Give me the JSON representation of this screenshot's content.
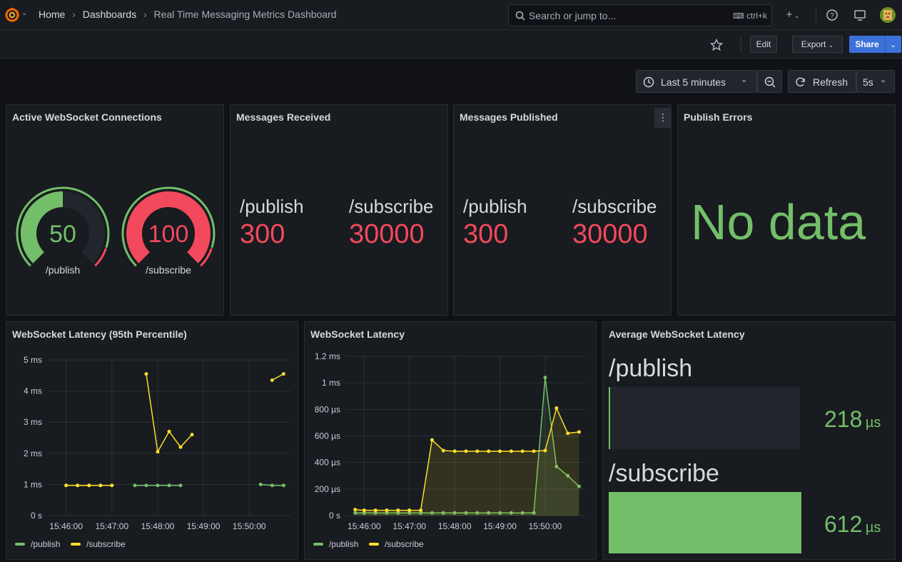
{
  "breadcrumb": {
    "home": "Home",
    "dashboards": "Dashboards",
    "current": "Real Time Messaging Metrics Dashboard"
  },
  "search": {
    "placeholder": "Search or jump to...",
    "shortcut": "ctrl+k"
  },
  "toolbar": {
    "edit": "Edit",
    "export": "Export",
    "share": "Share"
  },
  "time": {
    "range": "Last 5 minutes",
    "refresh": "Refresh",
    "interval": "5s"
  },
  "panels": {
    "connections": {
      "title": "Active WebSocket Connections",
      "gauges": [
        {
          "label": "/publish",
          "value": "50",
          "fraction": 0.5,
          "color": "#73bf69"
        },
        {
          "label": "/subscribe",
          "value": "100",
          "fraction": 1.0,
          "color": "#f2495c"
        }
      ]
    },
    "received": {
      "title": "Messages Received",
      "items": [
        {
          "label": "/publish",
          "value": "300"
        },
        {
          "label": "/subscribe",
          "value": "30000"
        }
      ]
    },
    "published": {
      "title": "Messages Published",
      "items": [
        {
          "label": "/publish",
          "value": "300"
        },
        {
          "label": "/subscribe",
          "value": "30000"
        }
      ]
    },
    "errors": {
      "title": "Publish Errors",
      "nodata": "No data"
    },
    "latency95": {
      "title": "WebSocket Latency (95th Percentile)"
    },
    "latency": {
      "title": "WebSocket Latency"
    },
    "avg": {
      "title": "Average WebSocket Latency",
      "items": [
        {
          "label": "/publish",
          "value": "218",
          "unit": "µs",
          "fraction": 0.0
        },
        {
          "label": "/subscribe",
          "value": "612",
          "unit": "µs",
          "fraction": 1.0
        }
      ]
    }
  },
  "chart_data": [
    {
      "type": "line",
      "title": "WebSocket Latency (95th Percentile)",
      "xticks": [
        "15:46:00",
        "15:47:00",
        "15:48:00",
        "15:49:00",
        "15:50:00"
      ],
      "yticks": [
        "0 s",
        "1 ms",
        "2 ms",
        "3 ms",
        "4 ms",
        "5 ms"
      ],
      "ylim": [
        0,
        5
      ],
      "legend": "bottom",
      "series": [
        {
          "name": "/publish",
          "color": "#73bf69",
          "segments": [
            [
              [
                0,
                0.97
              ],
              [
                0.25,
                0.97
              ],
              [
                0.5,
                0.97
              ],
              [
                0.75,
                0.97
              ],
              [
                1.0,
                0.97
              ]
            ],
            [
              [
                1.5,
                0.97
              ],
              [
                1.75,
                0.97
              ],
              [
                2.0,
                0.97
              ],
              [
                2.25,
                0.97
              ],
              [
                2.5,
                0.97
              ]
            ],
            [
              [
                4.25,
                1.0
              ],
              [
                4.5,
                0.97
              ],
              [
                4.75,
                0.97
              ]
            ]
          ]
        },
        {
          "name": "/subscribe",
          "color": "#fade2a",
          "segments": [
            [
              [
                0,
                0.97
              ],
              [
                0.25,
                0.97
              ],
              [
                0.5,
                0.97
              ],
              [
                0.75,
                0.97
              ],
              [
                1.0,
                0.97
              ]
            ],
            [
              [
                1.75,
                4.55
              ],
              [
                2.0,
                2.05
              ],
              [
                2.25,
                2.7
              ],
              [
                2.5,
                2.2
              ],
              [
                2.75,
                2.6
              ]
            ],
            [
              [
                4.5,
                4.35
              ],
              [
                4.75,
                4.55
              ]
            ]
          ]
        }
      ]
    },
    {
      "type": "area",
      "title": "WebSocket Latency",
      "xticks": [
        "15:46:00",
        "15:47:00",
        "15:48:00",
        "15:49:00",
        "15:50:00"
      ],
      "yticks": [
        "0 s",
        "200 µs",
        "400 µs",
        "600 µs",
        "800 µs",
        "1 ms",
        "1.2 ms"
      ],
      "ylim": [
        0,
        1200
      ],
      "legend": "bottom",
      "series": [
        {
          "name": "/publish",
          "color": "#73bf69",
          "points": [
            [
              -0.2,
              20
            ],
            [
              0,
              20
            ],
            [
              0.25,
              20
            ],
            [
              0.5,
              20
            ],
            [
              0.75,
              20
            ],
            [
              1.0,
              20
            ],
            [
              1.25,
              20
            ],
            [
              1.5,
              20
            ],
            [
              1.75,
              20
            ],
            [
              2.0,
              20
            ],
            [
              2.25,
              20
            ],
            [
              2.5,
              20
            ],
            [
              2.75,
              20
            ],
            [
              3.0,
              20
            ],
            [
              3.25,
              20
            ],
            [
              3.5,
              20
            ],
            [
              3.75,
              20
            ],
            [
              4.0,
              1040
            ],
            [
              4.25,
              370
            ],
            [
              4.5,
              300
            ],
            [
              4.75,
              220
            ]
          ]
        },
        {
          "name": "/subscribe",
          "color": "#fade2a",
          "points": [
            [
              -0.2,
              45
            ],
            [
              0,
              40
            ],
            [
              0.25,
              40
            ],
            [
              0.5,
              40
            ],
            [
              0.75,
              40
            ],
            [
              1.0,
              40
            ],
            [
              1.25,
              40
            ],
            [
              1.5,
              570
            ],
            [
              1.75,
              490
            ],
            [
              2.0,
              485
            ],
            [
              2.25,
              485
            ],
            [
              2.5,
              485
            ],
            [
              2.75,
              485
            ],
            [
              3.0,
              485
            ],
            [
              3.25,
              485
            ],
            [
              3.5,
              485
            ],
            [
              3.75,
              485
            ],
            [
              4.0,
              490
            ],
            [
              4.25,
              810
            ],
            [
              4.5,
              620
            ],
            [
              4.75,
              630
            ]
          ]
        }
      ]
    }
  ]
}
